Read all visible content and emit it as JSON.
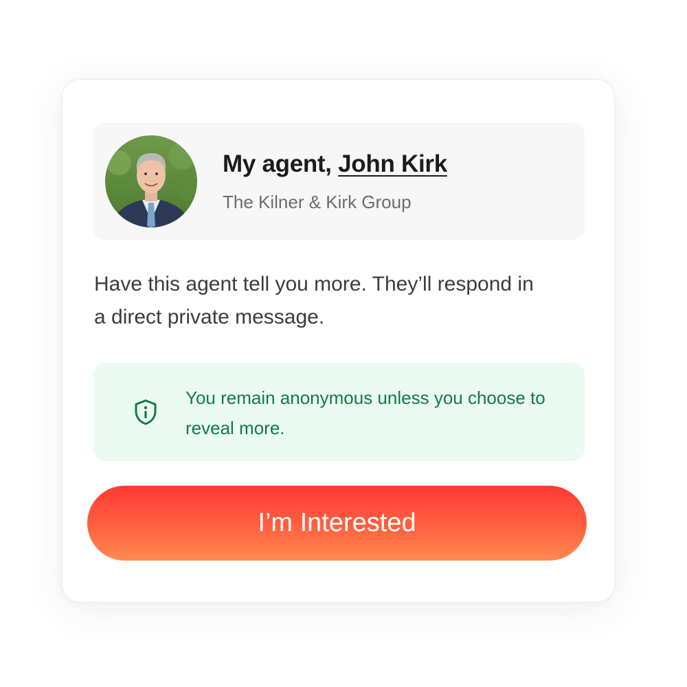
{
  "agent": {
    "heading_prefix": "My agent, ",
    "name": "John Kirk",
    "company": "The Kilner & Kirk Group",
    "avatar_icon": "agent-photo"
  },
  "description": "Have this agent tell you more. They’ll respond in a direct private message.",
  "notice": {
    "icon": "shield-info-icon",
    "text": "You remain anonymous unless you choose to reveal more."
  },
  "cta": {
    "label": "I’m Interested"
  },
  "colors": {
    "notice_background": "#ebfbf2",
    "notice_text": "#117a45",
    "cta_gradient_top": "#ff3a34",
    "cta_gradient_bottom": "#ff8a4f",
    "agent_box_background": "#f7f7f7"
  }
}
